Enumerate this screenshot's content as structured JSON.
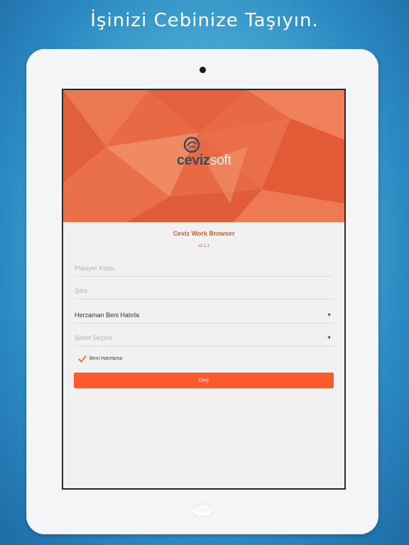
{
  "headline": "İşinizi Cebinize Taşıyın.",
  "app": {
    "logo_part1": "ceviz",
    "logo_part2": "soft",
    "title": "Ceviz Work Browser",
    "version": "v2.1.1"
  },
  "form": {
    "dealer_code_placeholder": "Plasiyer Kodu",
    "password_placeholder": "Şifre",
    "remember_mode": {
      "selected": "Herzaman Beni Hatırla"
    },
    "company_select": {
      "placeholder": "Şirket Seçimi"
    },
    "remember_checkbox": {
      "label": "Beni Hatırlama",
      "checked": true
    },
    "login_button": "Giriş"
  },
  "colors": {
    "accent": "#fc5a2a",
    "hero": "#e86a45",
    "title": "#e8592b"
  }
}
